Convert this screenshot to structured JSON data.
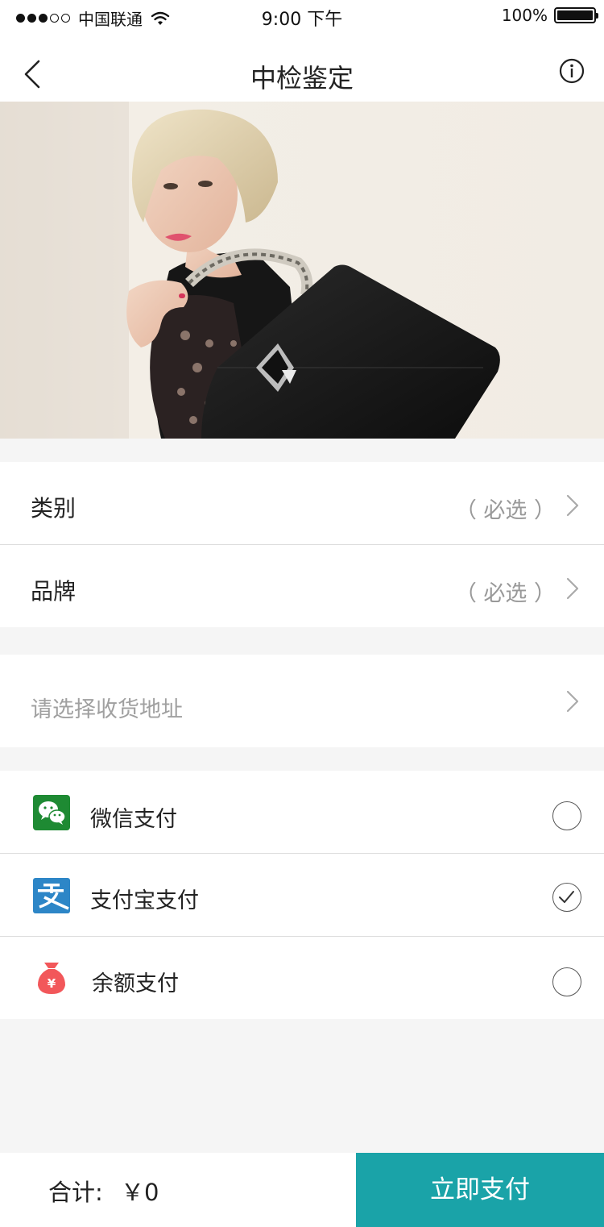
{
  "status_bar": {
    "carrier": "中国联通",
    "time": "9:00 下午",
    "battery": "100%",
    "signal_bars_filled": 3,
    "signal_bars_total": 5
  },
  "nav": {
    "title": "中检鉴定",
    "back_icon": "chevron-left-icon",
    "info_icon": "info-circle-icon"
  },
  "hero": {
    "image": "fashion-model-black-handbag-photo"
  },
  "form": {
    "category": {
      "label": "类别",
      "value": "（ 必选 ）"
    },
    "brand": {
      "label": "品牌",
      "value": "（ 必选 ）"
    }
  },
  "address": {
    "placeholder": "请选择收货地址"
  },
  "payment": {
    "options": [
      {
        "label": "微信支付",
        "icon": "wechat-icon",
        "color": "#1e8a33",
        "selected": false
      },
      {
        "label": "支付宝支付",
        "icon": "alipay-icon",
        "color": "#2d86c7",
        "selected": true
      },
      {
        "label": "余额支付",
        "icon": "money-bag-icon",
        "color": "#f2575a",
        "selected": false
      }
    ]
  },
  "footer": {
    "total_label": "合计:",
    "total_value": "￥0",
    "pay_button": "立即支付",
    "accent": "#1aa3a8"
  }
}
